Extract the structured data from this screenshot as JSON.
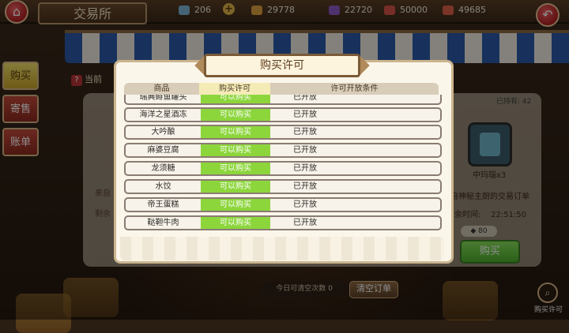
{
  "header": {
    "title": "交易所",
    "resources": [
      {
        "icon": "gem-icon",
        "value": "206",
        "color": "#7fb6d8"
      },
      {
        "icon": "potion-icon",
        "value": "29778",
        "color": "#e0a340"
      },
      {
        "icon": "crystal-icon",
        "value": "22720",
        "color": "#8c5cc7"
      },
      {
        "icon": "cake-icon",
        "value": "50000",
        "color": "#d9524a"
      },
      {
        "icon": "fruit-icon",
        "value": "49685",
        "color": "#e0604a"
      }
    ],
    "plus": "+"
  },
  "sidebar": {
    "items": [
      {
        "label": "购买"
      },
      {
        "label": "寄售"
      },
      {
        "label": "账单"
      }
    ]
  },
  "background": {
    "current_label": "当前",
    "left_line1": "来自",
    "left_line2": "剩余",
    "owned": "已持有: 42",
    "item_label": "中玛瑙x3",
    "order_text": "自神秘主厨的交易订单",
    "time_label": "余时间:",
    "time_value": "22:51:50",
    "price": "80",
    "buy_button": "购买",
    "clear_count_label": "今日可清空次数",
    "clear_count_value": "0",
    "clear_button": "清空订单",
    "permit_corner_label": "购买许可"
  },
  "modal": {
    "title": "购买许可",
    "columns": [
      "商品",
      "购买许可",
      "许可开放条件"
    ],
    "rows": [
      {
        "name": "瑞典鲱鱼罐头",
        "permit": "可以购买",
        "condition": "已开放"
      },
      {
        "name": "海洋之星酒冻",
        "permit": "可以购买",
        "condition": "已开放"
      },
      {
        "name": "大吟酿",
        "permit": "可以购买",
        "condition": "已开放"
      },
      {
        "name": "麻婆豆腐",
        "permit": "可以购买",
        "condition": "已开放"
      },
      {
        "name": "龙须糖",
        "permit": "可以购买",
        "condition": "已开放"
      },
      {
        "name": "水饺",
        "permit": "可以购买",
        "condition": "已开放"
      },
      {
        "name": "帝王蛋糕",
        "permit": "可以购买",
        "condition": "已开放"
      },
      {
        "name": "鞑靼牛肉",
        "permit": "可以购买",
        "condition": "已开放"
      }
    ]
  }
}
